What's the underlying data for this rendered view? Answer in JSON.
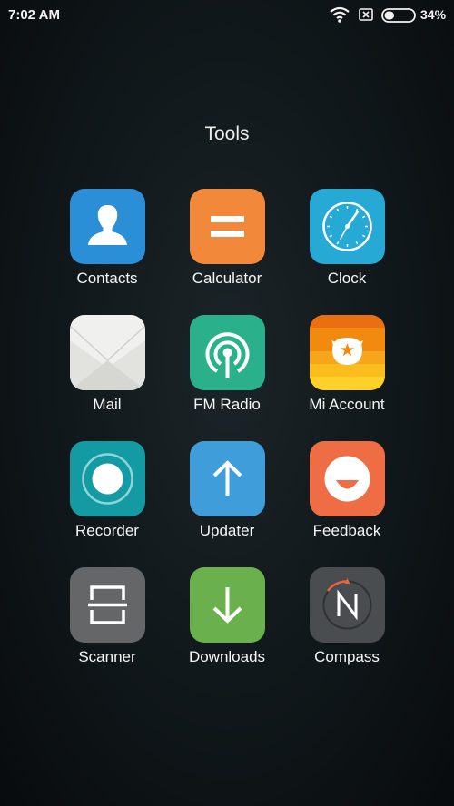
{
  "status_bar": {
    "time": "7:02 AM",
    "battery_percent": "34%",
    "battery_level": 0.34
  },
  "folder": {
    "title": "Tools"
  },
  "apps": [
    {
      "label": "Contacts",
      "icon": "contacts-icon",
      "color": "#2b8fd8"
    },
    {
      "label": "Calculator",
      "icon": "calculator-icon",
      "color": "#f2883a"
    },
    {
      "label": "Clock",
      "icon": "clock-icon",
      "color": "#27a9d6"
    },
    {
      "label": "Mail",
      "icon": "mail-icon",
      "color": "#f0f0ee"
    },
    {
      "label": "FM Radio",
      "icon": "fm-radio-icon",
      "color": "#2bb08c"
    },
    {
      "label": "Mi Account",
      "icon": "mi-account-icon",
      "color": "#f28a10"
    },
    {
      "label": "Recorder",
      "icon": "recorder-icon",
      "color": "#149aa3"
    },
    {
      "label": "Updater",
      "icon": "updater-icon",
      "color": "#3f9ed9"
    },
    {
      "label": "Feedback",
      "icon": "feedback-icon",
      "color": "#ee6d45"
    },
    {
      "label": "Scanner",
      "icon": "scanner-icon",
      "color": "#646667"
    },
    {
      "label": "Downloads",
      "icon": "downloads-icon",
      "color": "#6ab04c"
    },
    {
      "label": "Compass",
      "icon": "compass-icon",
      "color": "#4a4d50"
    }
  ]
}
